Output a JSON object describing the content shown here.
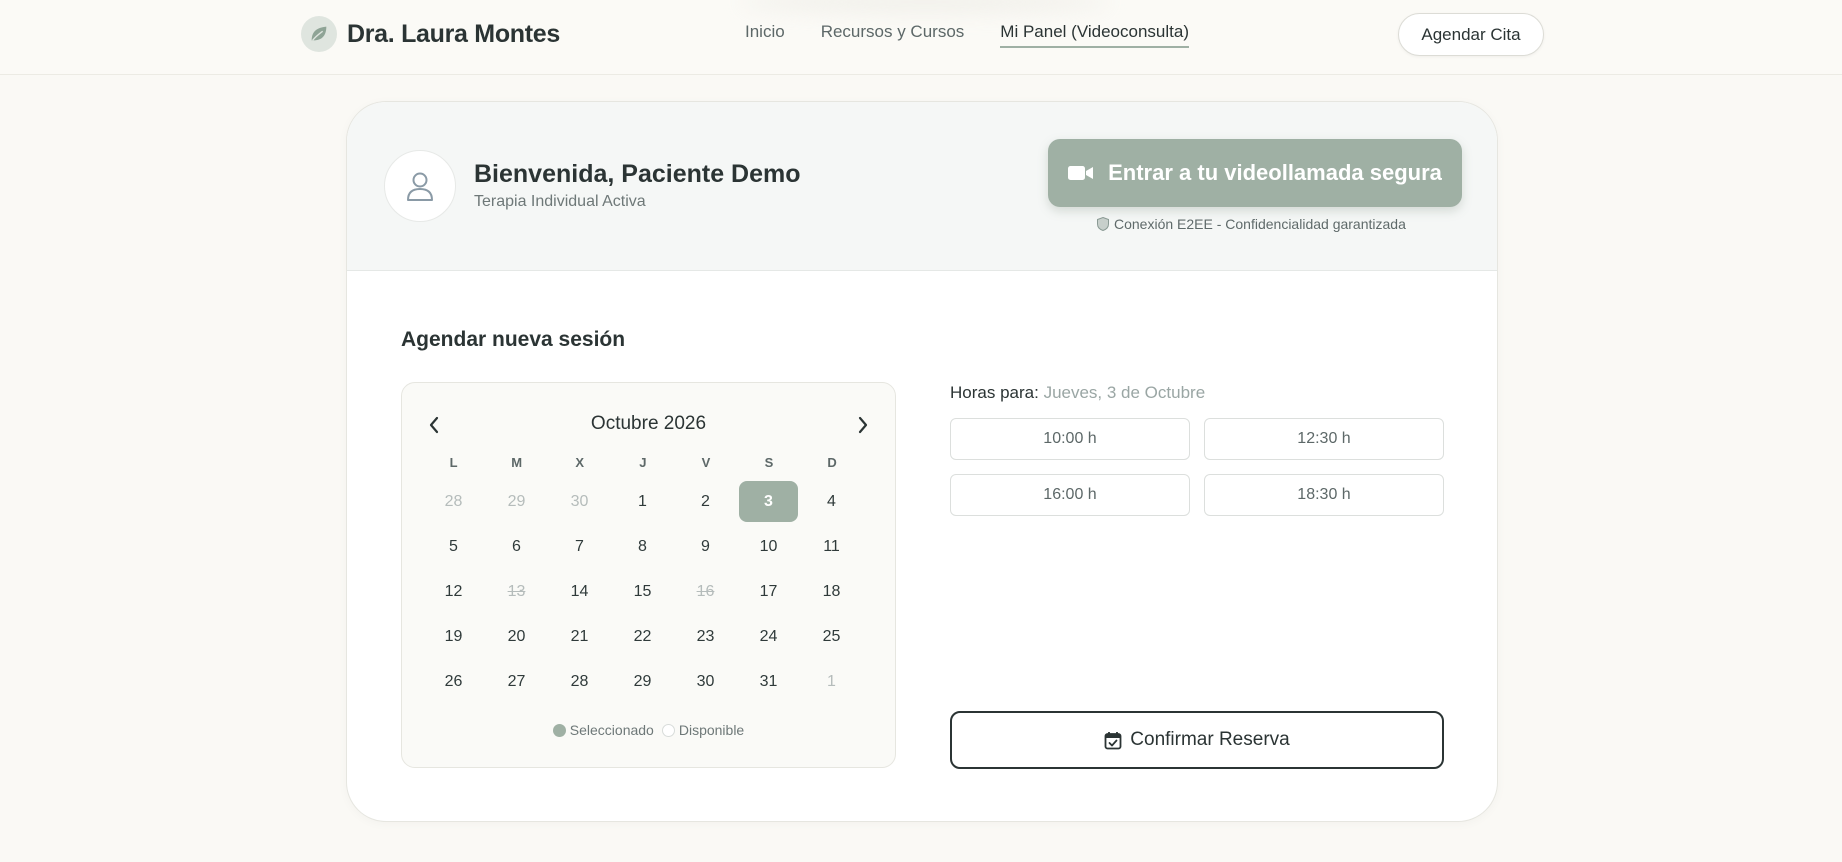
{
  "header": {
    "brand_name": "Dra. Laura Montes",
    "brand_icon": "leaf-icon",
    "nav": [
      {
        "label": "Inicio",
        "active": false
      },
      {
        "label": "Recursos y Cursos",
        "active": false
      },
      {
        "label": "Mi Panel (Videoconsulta)",
        "active": true
      }
    ],
    "cta_label": "Agendar Cita"
  },
  "profile": {
    "avatar_icon": "user-icon",
    "greeting": "Bienvenida, Paciente Demo",
    "subtitle": "Terapia Individual Activa"
  },
  "video": {
    "button_label": "Entrar a tu videollamada segura",
    "button_icon": "video-camera-icon",
    "security_note": "Conexión E2EE - Confidencialidad garantizada",
    "security_icon": "shield-icon"
  },
  "booking": {
    "section_title": "Agendar nueva sesión",
    "calendar": {
      "month_label": "Octubre 2026",
      "weekdays": [
        "L",
        "M",
        "X",
        "J",
        "V",
        "S",
        "D"
      ],
      "weeks": [
        [
          "28",
          "29",
          "30",
          "1",
          "2",
          "3",
          "4"
        ],
        [
          "5",
          "6",
          "7",
          "8",
          "9",
          "10",
          "11"
        ],
        [
          "12",
          "13",
          "14",
          "15",
          "16",
          "17",
          "18"
        ],
        [
          "19",
          "20",
          "21",
          "22",
          "23",
          "24",
          "25"
        ],
        [
          "26",
          "27",
          "28",
          "29",
          "30",
          "31",
          "1"
        ]
      ],
      "muted_cells": [
        "0-0",
        "0-1",
        "0-2",
        "4-6"
      ],
      "unavailable_cells": [
        "2-1",
        "2-4"
      ],
      "selected_cell": "0-5",
      "legend_selected": "Seleccionado",
      "legend_available": "Disponible"
    },
    "hours_label": "Horas para:",
    "hours_date": "Jueves, 3 de Octubre",
    "slots": [
      "10:00 h",
      "12:30 h",
      "16:00 h",
      "18:30 h"
    ],
    "confirm_label": "Confirmar Reserva",
    "confirm_icon": "calendar-check-icon"
  },
  "colors": {
    "accent": "#9fb0a4",
    "background": "#faf9f5",
    "text": "#2b3434"
  }
}
